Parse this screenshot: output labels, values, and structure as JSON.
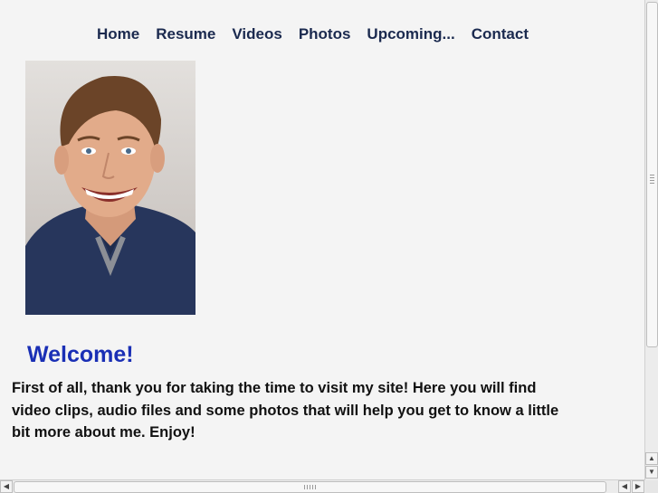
{
  "nav": {
    "items": [
      {
        "label": "Home"
      },
      {
        "label": "Resume"
      },
      {
        "label": "Videos"
      },
      {
        "label": "Photos"
      },
      {
        "label": "Upcoming..."
      },
      {
        "label": "Contact"
      }
    ]
  },
  "main": {
    "heading": "Welcome!",
    "intro": "First of all, thank you for taking the time to visit my site! Here you will find video clips, audio files and some photos that will help you get to know a little bit more about me. Enjoy!"
  },
  "colors": {
    "background": "#f4f4f4",
    "nav_text": "#1b2a4f",
    "heading": "#1a2fb5",
    "body_text": "#111111"
  },
  "icons": {
    "scroll_up": "arrow-up-icon",
    "scroll_down": "arrow-down-icon",
    "scroll_left": "arrow-left-icon",
    "scroll_right": "arrow-right-icon"
  }
}
